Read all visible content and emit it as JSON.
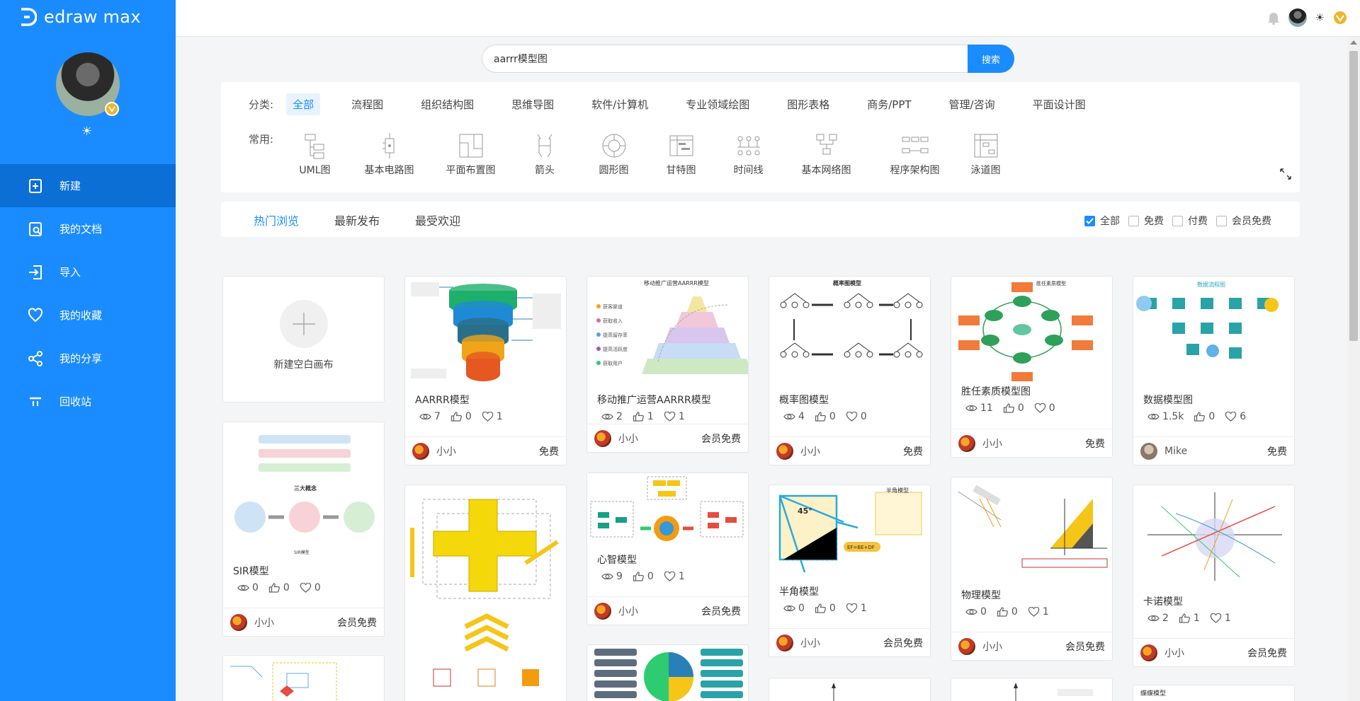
{
  "brand": {
    "name": "edraw max"
  },
  "nav": [
    {
      "label": "新建",
      "icon": "new-file-icon",
      "active": true
    },
    {
      "label": "我的文档",
      "icon": "document-icon",
      "active": false
    },
    {
      "label": "导入",
      "icon": "import-icon",
      "active": false
    },
    {
      "label": "我的收藏",
      "icon": "heart-icon",
      "active": false
    },
    {
      "label": "我的分享",
      "icon": "share-icon",
      "active": false
    },
    {
      "label": "回收站",
      "icon": "trash-icon",
      "active": false
    }
  ],
  "search": {
    "value": "aarrr模型图",
    "button": "搜索"
  },
  "categories": {
    "label": "分类:",
    "items": [
      "全部",
      "流程图",
      "组织结构图",
      "思维导图",
      "软件/计算机",
      "专业领域绘图",
      "图形表格",
      "商务/PPT",
      "管理/咨询",
      "平面设计图"
    ],
    "active_index": 0
  },
  "common": {
    "label": "常用:",
    "items": [
      "UML图",
      "基本电路图",
      "平面布置图",
      "箭头",
      "圆形图",
      "甘特图",
      "时间线",
      "基本网络图",
      "程序架构图",
      "泳道图"
    ]
  },
  "tabs": {
    "items": [
      "热门浏览",
      "最新发布",
      "最受欢迎"
    ],
    "active_index": 0
  },
  "filters": [
    {
      "label": "全部",
      "checked": true
    },
    {
      "label": "免费",
      "checked": false
    },
    {
      "label": "付费",
      "checked": false
    },
    {
      "label": "会员免费",
      "checked": false
    }
  ],
  "new_canvas": {
    "label": "新建空白画布"
  },
  "cards": [
    {
      "title": "AARRR模型",
      "views": "7",
      "likes": "0",
      "favs": "1",
      "user": "小小",
      "price": "免费",
      "thumb": "funnel"
    },
    {
      "title": "移动推广运营AARRR模型",
      "views": "2",
      "likes": "1",
      "favs": "1",
      "user": "小小",
      "price": "会员免费",
      "thumb": "pyramid",
      "thumb_title": "移动推广运营AARRR模型",
      "thumb_items": [
        "获客渠道",
        "获取收入",
        "提高留存率",
        "提高活跃度",
        "获取用户"
      ]
    },
    {
      "title": "概率图模型",
      "views": "4",
      "likes": "0",
      "favs": "0",
      "user": "小小",
      "price": "免费",
      "thumb": "prob",
      "thumb_title": "概率图模型"
    },
    {
      "title": "胜任素质模型图",
      "views": "11",
      "likes": "0",
      "favs": "0",
      "user": "小小",
      "price": "免费",
      "thumb": "competency",
      "thumb_title": "胜任素质模型"
    },
    {
      "title": "数据模型图",
      "views": "1.5k",
      "likes": "0",
      "favs": "6",
      "user": "Mike",
      "price": "免费",
      "thumb": "datamodel",
      "thumb_title": "数据流程图"
    },
    {
      "title": "SIR模型",
      "views": "0",
      "likes": "0",
      "favs": "0",
      "user": "小小",
      "price": "会员免费",
      "thumb": "sir",
      "thumb_title": "三大概念",
      "thumb_sub": "SIR模型"
    },
    {
      "title": "",
      "thumb": "cube3d"
    },
    {
      "title": "心智模型",
      "views": "9",
      "likes": "0",
      "favs": "1",
      "user": "小小",
      "price": "会员免费",
      "thumb": "mind"
    },
    {
      "title": "半角模型",
      "views": "0",
      "likes": "0",
      "favs": "1",
      "user": "小小",
      "price": "会员免费",
      "thumb": "halfangle",
      "thumb_title": "半角模型",
      "thumb_eq": "EF=BE+DF",
      "thumb_angle": "45°"
    },
    {
      "title": "物理模型",
      "views": "0",
      "likes": "0",
      "favs": "1",
      "user": "小小",
      "price": "会员免费",
      "thumb": "physics"
    },
    {
      "title": "卡诺模型",
      "views": "2",
      "likes": "1",
      "favs": "1",
      "user": "小小",
      "price": "会员免费",
      "thumb": "kano"
    },
    {
      "title": "",
      "thumb": "bottom1"
    },
    {
      "title": "",
      "thumb": "wheel"
    },
    {
      "title": "",
      "thumb": "bottom3"
    },
    {
      "title": "",
      "thumb": "bottom4"
    },
    {
      "title": "",
      "thumb": "butterfly",
      "thumb_title": "蝶蝶模型"
    }
  ],
  "colors": {
    "primary": "#1a8cff",
    "sidebar_active": "#0b6fd6"
  }
}
